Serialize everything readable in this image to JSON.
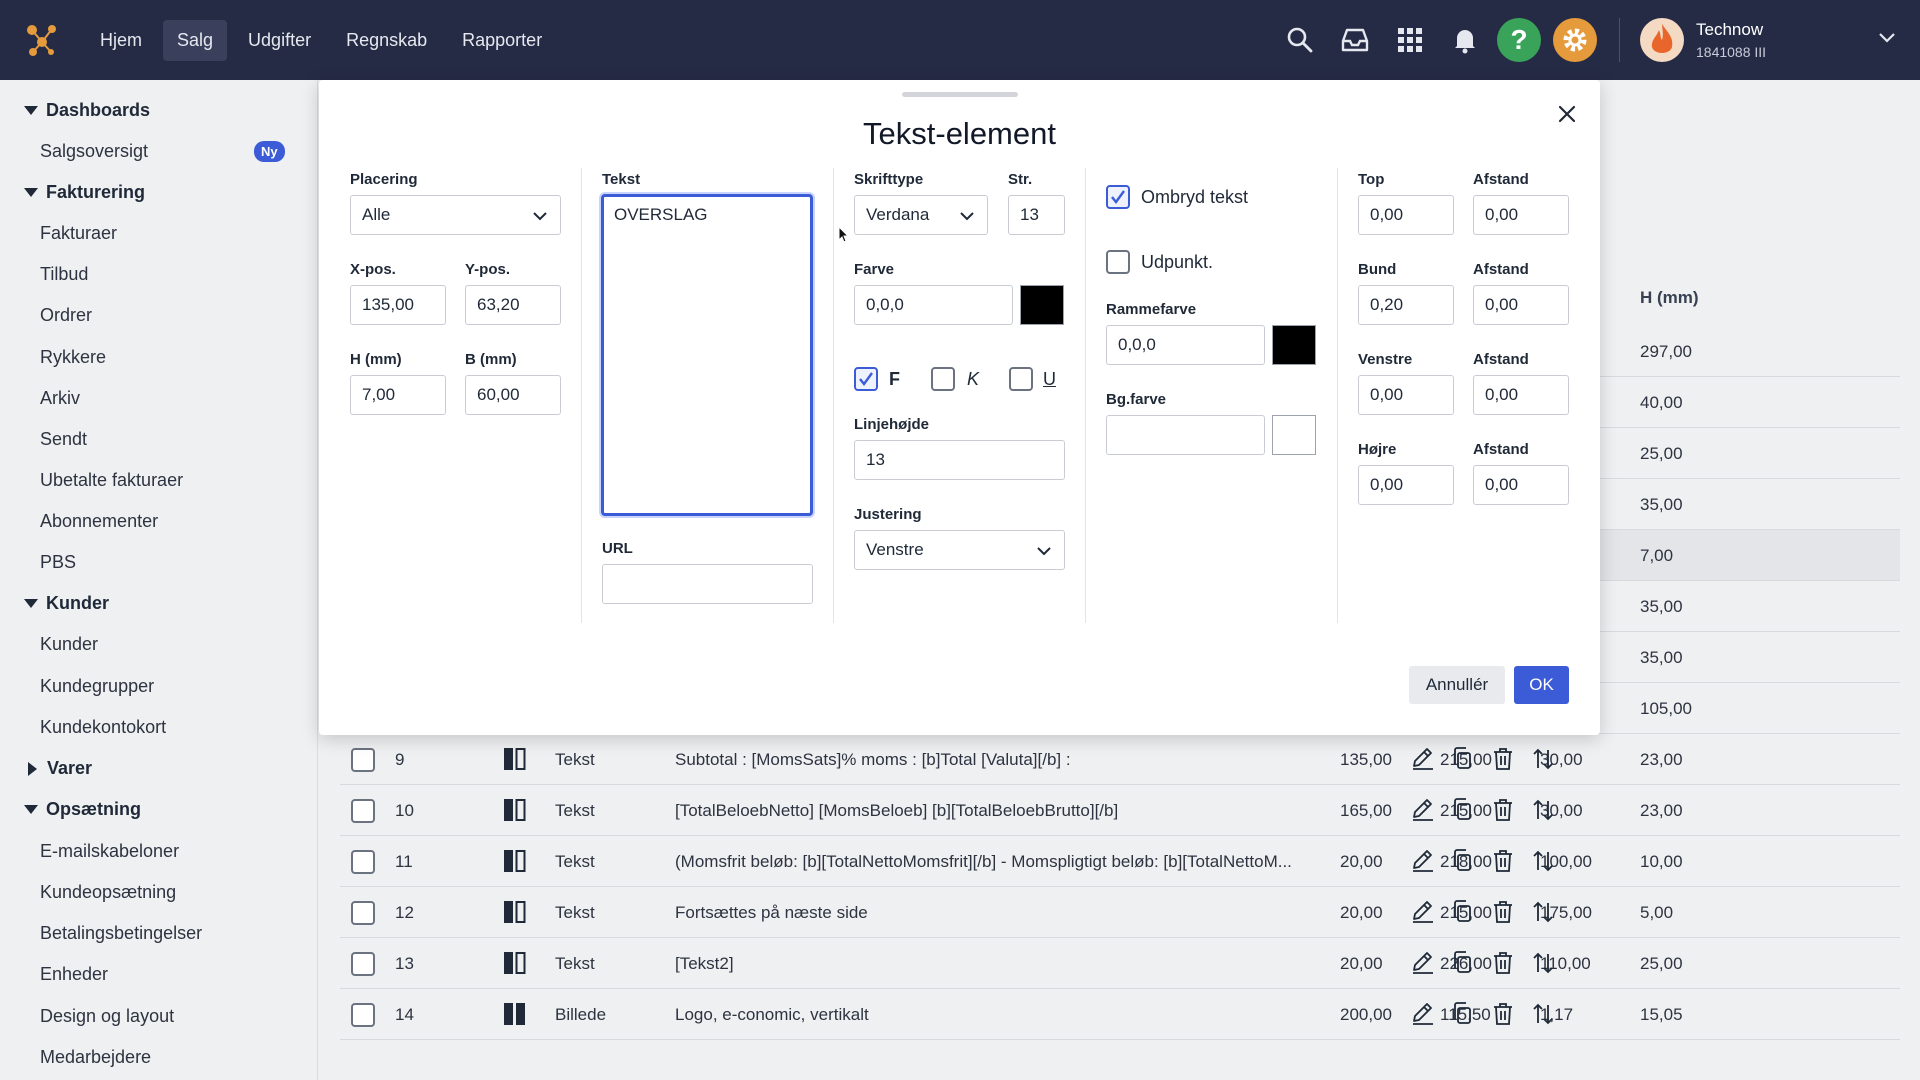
{
  "nav": {
    "items": [
      "Hjem",
      "Salg",
      "Udgifter",
      "Regnskab",
      "Rapporter"
    ],
    "user_name": "Technow",
    "user_id": "1841088 III"
  },
  "sidebar": {
    "dashboards": "Dashboards",
    "salgsoversigt": "Salgsoversigt",
    "badge": "Ny",
    "fakturering": "Fakturering",
    "fakturaer": "Fakturaer",
    "tilbud": "Tilbud",
    "ordrer": "Ordrer",
    "rykkere": "Rykkere",
    "arkiv": "Arkiv",
    "sendt": "Sendt",
    "ubetalte": "Ubetalte fakturaer",
    "abonnementer": "Abonnementer",
    "pbs": "PBS",
    "kunder_head": "Kunder",
    "kunder": "Kunder",
    "kundegrupper": "Kundegrupper",
    "kundekontokort": "Kundekontokort",
    "varer": "Varer",
    "opsaetning": "Opsætning",
    "emailskabeloner": "E-mailskabeloner",
    "kundeopsaetning": "Kundeopsætning",
    "betalingsbetingelser": "Betalingsbetingelser",
    "enheder": "Enheder",
    "design": "Design og layout",
    "medarbejdere": "Medarbejdere"
  },
  "table": {
    "h_header": "H (mm)",
    "upper_h": [
      "297,00",
      "40,00",
      "25,00",
      "35,00",
      "7,00",
      "35,00",
      "35,00",
      "105,00"
    ],
    "rows": [
      {
        "n": "9",
        "type": "Tekst",
        "content": "Subtotal : [MomsSats]% moms : [b]Total [Valuta][/b] :",
        "x": "135,00",
        "y": "215,00",
        "b": "30,00",
        "h": "23,00"
      },
      {
        "n": "10",
        "type": "Tekst",
        "content": "[TotalBeloebNetto] [MomsBeloeb] [b][TotalBeloebBrutto][/b]",
        "x": "165,00",
        "y": "215,00",
        "b": "30,00",
        "h": "23,00"
      },
      {
        "n": "11",
        "type": "Tekst",
        "content": "(Momsfrit beløb: [b][TotalNettoMomsfrit][/b] - Momspligtigt beløb: [b][TotalNettoM...",
        "x": "20,00",
        "y": "218,00",
        "b": "100,00",
        "h": "10,00"
      },
      {
        "n": "12",
        "type": "Tekst",
        "content": "Fortsættes på næste side",
        "x": "20,00",
        "y": "215,00",
        "b": "175,00",
        "h": "5,00"
      },
      {
        "n": "13",
        "type": "Tekst",
        "content": "[Tekst2]",
        "x": "20,00",
        "y": "226,00",
        "b": "110,00",
        "h": "25,00"
      },
      {
        "n": "14",
        "type": "Billede",
        "content": "Logo, e-conomic, vertikalt",
        "x": "200,00",
        "y": "115,50",
        "b": "1,17",
        "h": "15,05"
      }
    ]
  },
  "modal": {
    "title": "Tekst-element",
    "placering_label": "Placering",
    "placering_value": "Alle",
    "xpos_label": "X-pos.",
    "xpos_value": "135,00",
    "ypos_label": "Y-pos.",
    "ypos_value": "63,20",
    "h_label": "H (mm)",
    "h_value": "7,00",
    "b_label": "B (mm)",
    "b_value": "60,00",
    "tekst_label": "Tekst",
    "tekst_value": "OVERSLAG",
    "url_label": "URL",
    "url_value": "",
    "skrifttype_label": "Skrifttype",
    "skrifttype_value": "Verdana",
    "str_label": "Str.",
    "str_value": "13",
    "farve_label": "Farve",
    "farve_value": "0,0,0",
    "farve_color": "#000000",
    "bold_label": "F",
    "italic_label": "K",
    "underline_label": "U",
    "bold_checked": true,
    "italic_checked": false,
    "underline_checked": false,
    "linjehojde_label": "Linjehøjde",
    "linjehojde_value": "13",
    "justering_label": "Justering",
    "justering_value": "Venstre",
    "ombryd_label": "Ombryd tekst",
    "ombryd_checked": true,
    "udpunkt_label": "Udpunkt.",
    "udpunkt_checked": false,
    "rammefarve_label": "Rammefarve",
    "rammefarve_value": "0,0,0",
    "rammefarve_color": "#000000",
    "bgfarve_label": "Bg.farve",
    "bgfarve_value": "",
    "bgfarve_color": "#ffffff",
    "top_label": "Top",
    "top_value": "0,00",
    "top_afstand_label": "Afstand",
    "top_afstand_value": "0,00",
    "bund_label": "Bund",
    "bund_value": "0,20",
    "bund_afstand_label": "Afstand",
    "bund_afstand_value": "0,00",
    "venstre_label": "Venstre",
    "venstre_value": "0,00",
    "venstre_afstand_label": "Afstand",
    "venstre_afstand_value": "0,00",
    "hojre_label": "Højre",
    "hojre_value": "0,00",
    "hojre_afstand_label": "Afstand",
    "hojre_afstand_value": "0,00",
    "cancel_label": "Annullér",
    "ok_label": "OK"
  },
  "colors": {
    "topbar": "#262b45",
    "accent": "#3c5bd6",
    "help": "#3aa35a",
    "settings": "#e59a3c"
  }
}
